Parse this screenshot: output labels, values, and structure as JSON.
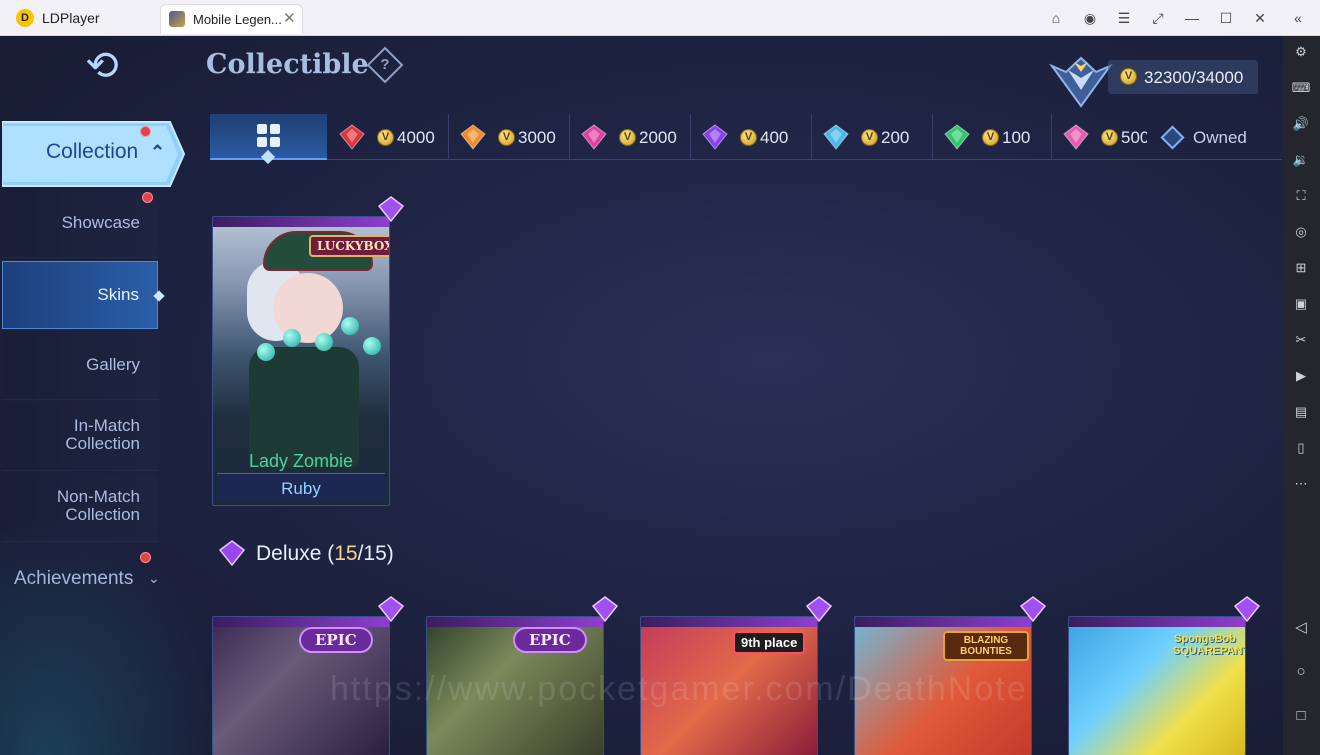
{
  "emulator": {
    "name": "LDPlayer",
    "tab_title": "Mobile Legen...",
    "tab_close": "✕",
    "window_buttons": [
      "gift-icon",
      "account-icon",
      "menu-icon",
      "screen-rotate-icon",
      "minimize-icon",
      "maximize-icon",
      "close-icon",
      "collapse-sidebar-icon"
    ],
    "window_glyphs": [
      "⌂",
      "◉",
      "☰",
      "⤢",
      "—",
      "☐",
      "✕",
      "«"
    ]
  },
  "side_tools": {
    "items": [
      "settings-icon",
      "keyboard-icon",
      "volume-up-icon",
      "volume-down-icon",
      "screenshot-icon",
      "location-icon",
      "add-app-icon",
      "apk-icon",
      "scissors-icon",
      "record-icon",
      "folder-icon",
      "shake-icon",
      "more-icon"
    ],
    "glyphs": [
      "⚙",
      "⌨",
      "🔊",
      "🔉",
      "⛶",
      "◎",
      "⊞",
      "▣",
      "✂",
      "▶",
      "▤",
      "▯",
      "⋯"
    ],
    "nav_glyphs": [
      "◁",
      "○",
      "□"
    ]
  },
  "header": {
    "back_glyph": "⟲",
    "title": "Collectible",
    "help_glyph": "?",
    "points": "32300/34000",
    "coin_glyph": "V"
  },
  "sidebar": {
    "collection": {
      "label": "Collection",
      "chevron": "⌃"
    },
    "items": [
      {
        "label": "Showcase",
        "active": false
      },
      {
        "label": "Skins",
        "active": true
      },
      {
        "label": "Gallery",
        "active": false
      },
      {
        "label": "In-Match Collection",
        "active": false
      },
      {
        "label": "Non-Match Collection",
        "active": false
      }
    ],
    "achievements": {
      "label": "Achievements",
      "chevron": "⌄"
    }
  },
  "filters": {
    "tabs": [
      {
        "price": "4000",
        "gem_color": "#e2323a"
      },
      {
        "price": "3000",
        "gem_color": "#f08a2c"
      },
      {
        "price": "2000",
        "gem_color": "#e040a0"
      },
      {
        "price": "400",
        "gem_color": "#8b3ff0"
      },
      {
        "price": "200",
        "gem_color": "#4ab8e8"
      },
      {
        "price": "100",
        "gem_color": "#2fc86a"
      },
      {
        "price": "500",
        "gem_color": "#e85ab0"
      }
    ],
    "owned_label": "Owned"
  },
  "featured": {
    "badge": "LUCKYBOX",
    "name": "Lady Zombie",
    "tier": "Ruby"
  },
  "deluxe": {
    "title": "Deluxe",
    "owned": "15",
    "total": "15",
    "open": "(",
    "slash": "/",
    "close": ")",
    "cards": [
      {
        "badge": "EPIC"
      },
      {
        "badge": "EPIC"
      },
      {
        "badge": "9th place"
      },
      {
        "badge": "BLAZING BOUNTIES"
      },
      {
        "badge": "SpongeBob SQUAREPANTS"
      }
    ]
  },
  "watermark": "https://www.pocketgamer.com/DeathNote"
}
